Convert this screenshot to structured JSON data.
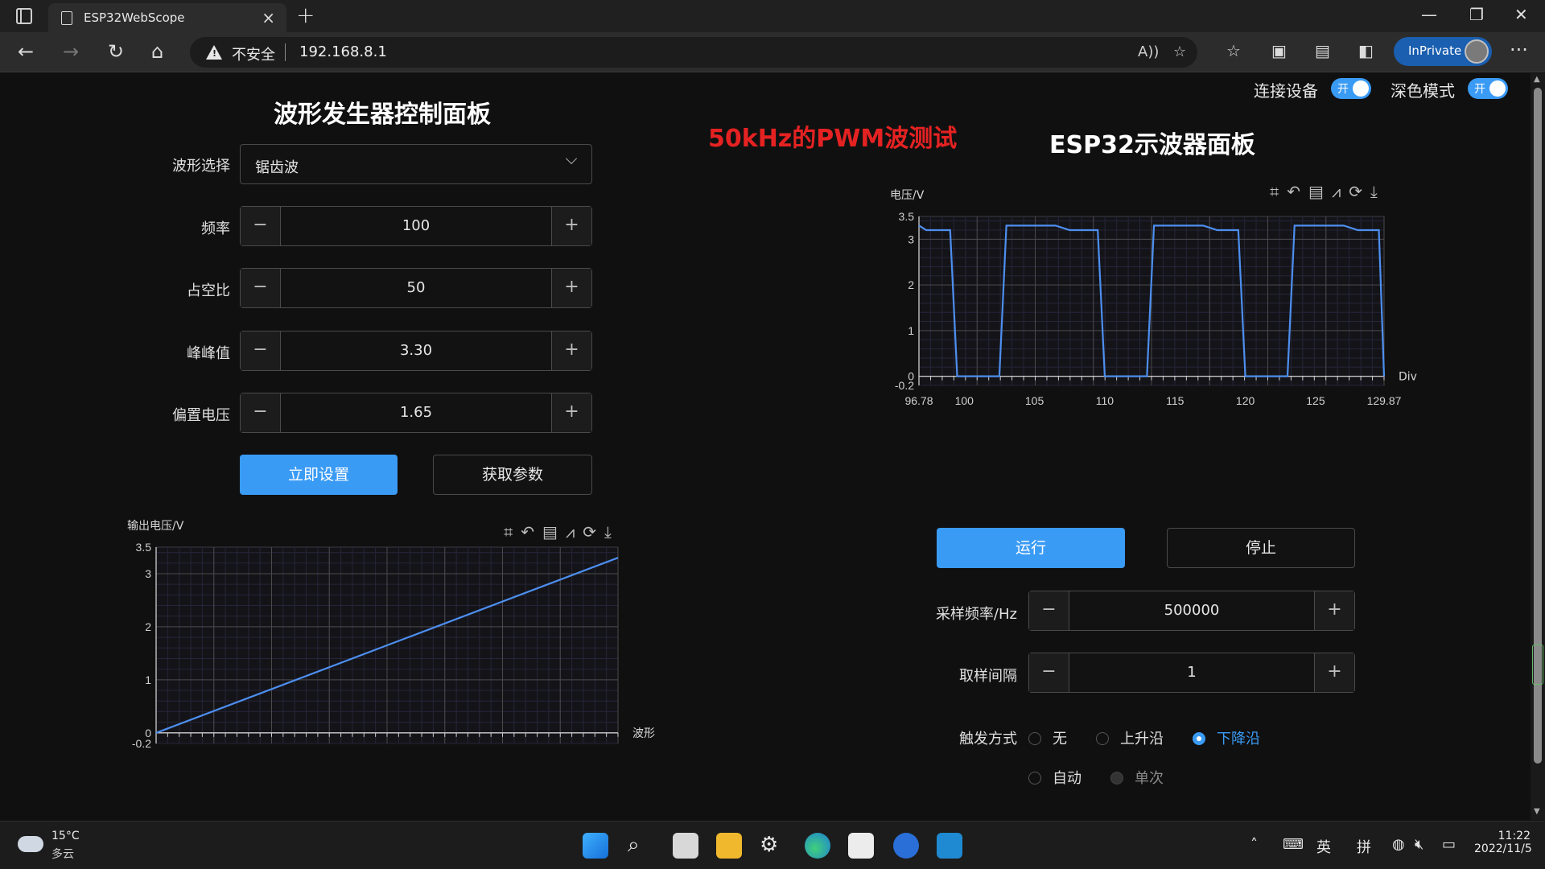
{
  "browser": {
    "tab_title": "ESP32WebScope",
    "address_warning": "不安全",
    "url": "192.168.8.1",
    "inprivate_label": "InPrivate"
  },
  "left_panel": {
    "title": "波形发生器控制面板",
    "waveform_label": "波形选择",
    "waveform_value": "锯齿波",
    "frequency_label": "频率",
    "frequency_value": "100",
    "duty_label": "占空比",
    "duty_value": "50",
    "peak_label": "峰峰值",
    "peak_value": "3.30",
    "offset_label": "偏置电压",
    "offset_value": "1.65",
    "apply_button": "立即设置",
    "fetch_button": "获取参数"
  },
  "annotation": "50kHz的PWM波测试",
  "toggles": {
    "connect_label": "连接设备",
    "connect_state": "开",
    "dark_label": "深色模式",
    "dark_state": "开"
  },
  "right_panel": {
    "title": "ESP32示波器面板",
    "run_button": "运行",
    "stop_button": "停止",
    "sample_rate_label": "采样频率/Hz",
    "sample_rate_value": "500000",
    "interval_label": "取样间隔",
    "interval_value": "1",
    "trigger_label": "触发方式",
    "trigger_options": [
      {
        "label": "无",
        "state": "unchecked"
      },
      {
        "label": "上升沿",
        "state": "unchecked"
      },
      {
        "label": "下降沿",
        "state": "checked"
      },
      {
        "label": "自动",
        "state": "unchecked"
      },
      {
        "label": "单次",
        "state": "disabled"
      }
    ]
  },
  "chart_data": [
    {
      "type": "line",
      "ylabel": "输出电压/V",
      "xlabel": "波形",
      "ylim": [
        -0.2,
        3.5
      ],
      "yticks": [
        "3.5",
        "3",
        "2",
        "1",
        "0",
        "-0.2"
      ],
      "grid": true,
      "series": [
        {
          "x": [
            0,
            1
          ],
          "y": [
            0,
            3.3
          ]
        }
      ],
      "color": "#4d8ff0"
    },
    {
      "type": "line",
      "ylabel": "电压/V",
      "xlabel": "Div",
      "ylim": [
        -0.2,
        3.5
      ],
      "xlim": [
        96.78,
        129.87
      ],
      "yticks": [
        "3.5",
        "3",
        "2",
        "1",
        "0",
        "-0.2"
      ],
      "xticks": [
        "96.78",
        "100",
        "105",
        "110",
        "115",
        "120",
        "125",
        "129.87"
      ],
      "grid": true,
      "series": [
        {
          "x": [
            96.78,
            97.3,
            97.9,
            99.0,
            99.5,
            102.5,
            103.0,
            106.0,
            106.5,
            107.5,
            109.5,
            110.0,
            113.0,
            113.5,
            116.5,
            117.0,
            118.0,
            119.5,
            120.0,
            123.0,
            123.5,
            126.5,
            127.0,
            128.0,
            129.5,
            129.87
          ],
          "y": [
            3.3,
            3.2,
            3.2,
            3.2,
            0.0,
            0.0,
            3.3,
            3.3,
            3.3,
            3.2,
            3.2,
            0.0,
            0.0,
            3.3,
            3.3,
            3.3,
            3.2,
            3.2,
            0.0,
            0.0,
            3.3,
            3.3,
            3.3,
            3.2,
            3.2,
            0.0
          ]
        }
      ],
      "color": "#4d8ff0"
    }
  ],
  "taskbar": {
    "temperature": "15°C",
    "weather": "多云",
    "ime_lang": "英",
    "ime_mode": "拼",
    "time": "11:22",
    "date": "2022/11/5"
  }
}
